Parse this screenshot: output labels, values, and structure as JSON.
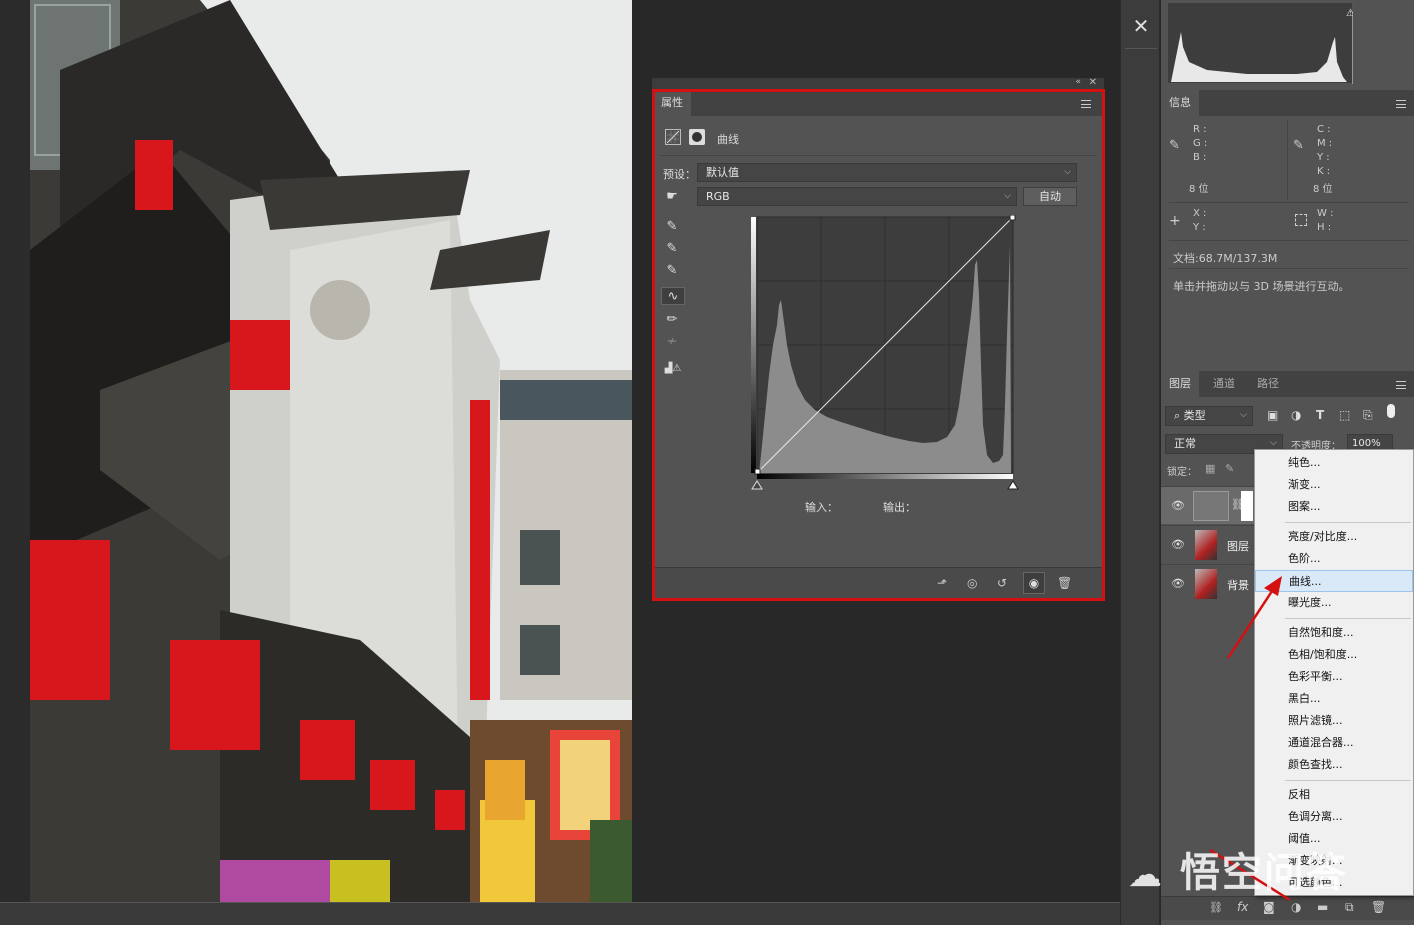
{
  "properties_panel": {
    "tab_label": "属性",
    "adjustment_title": "曲线",
    "preset_label": "预设：",
    "preset_value": "默认值",
    "channel_value": "RGB",
    "auto_button": "自动",
    "input_label": "输入：",
    "output_label": "输出："
  },
  "info_panel": {
    "tab_label": "信息",
    "rgb_labels": [
      "R :",
      "G :",
      "B :"
    ],
    "cmyk_labels": [
      "C :",
      "M :",
      "Y :",
      "K :"
    ],
    "bit_left": "8 位",
    "bit_right": "8 位",
    "xy_labels": [
      "X :",
      "Y :"
    ],
    "wh_labels": [
      "W :",
      "H :"
    ],
    "doc_size": "文档:68.7M/137.3M",
    "hint": "单击并拖动以与 3D 场景进行互动。"
  },
  "layers_panel": {
    "tabs": [
      "图层",
      "通道",
      "路径"
    ],
    "filter_value": "类型",
    "blend_mode": "正常",
    "opacity_label": "不透明度：",
    "opacity_value": "100%",
    "lock_label": "锁定：",
    "layers": [
      {
        "name": ""
      },
      {
        "name": "图层"
      },
      {
        "name": "背景"
      }
    ]
  },
  "adjustment_menu": {
    "group1": [
      "纯色...",
      "渐变...",
      "图案..."
    ],
    "group2": [
      "亮度/对比度...",
      "色阶...",
      "曲线...",
      "曝光度..."
    ],
    "group3": [
      "自然饱和度...",
      "色相/饱和度...",
      "色彩平衡...",
      "黑白...",
      "照片滤镜...",
      "通道混合器...",
      "颜色查找..."
    ],
    "group4": [
      "反相",
      "色调分离...",
      "阈值...",
      "渐变映射...",
      "可选颜色..."
    ],
    "highlighted": "曲线..."
  },
  "watermark": "悟空问答",
  "colors": {
    "highlight_red": "#d41010",
    "panel_gray": "#535353",
    "menu_bg": "#f0f0f0"
  }
}
